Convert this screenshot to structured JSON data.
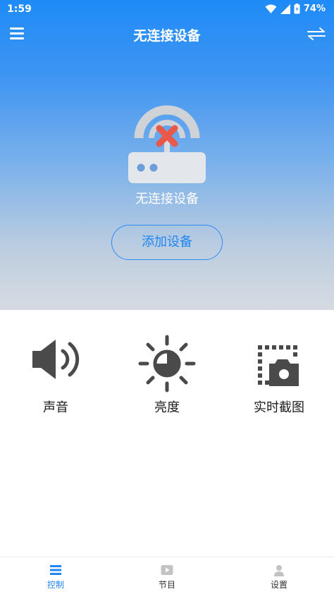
{
  "status_bar": {
    "time": "1:59",
    "battery": "74%"
  },
  "app_bar": {
    "title": "无连接设备",
    "menu_icon": "menu-icon",
    "swap_icon": "swap-icon"
  },
  "hero": {
    "illustration": "router-disconnected-icon",
    "status_text": "无连接设备",
    "add_button": "添加设备"
  },
  "controls": [
    {
      "label": "声音",
      "icon": "volume-icon"
    },
    {
      "label": "亮度",
      "icon": "brightness-icon"
    },
    {
      "label": "实时截图",
      "icon": "screenshot-icon"
    }
  ],
  "bottom_nav": [
    {
      "label": "控制",
      "icon": "list-icon",
      "active": true
    },
    {
      "label": "节目",
      "icon": "play-icon",
      "active": false
    },
    {
      "label": "设置",
      "icon": "person-icon",
      "active": false
    }
  ],
  "colors": {
    "accent": "#1f86f2",
    "hero_top": "#1e8bf7",
    "hero_bottom": "#d6dbe1",
    "icon_dark": "#4a4a4a",
    "error_red": "#e9594a"
  }
}
